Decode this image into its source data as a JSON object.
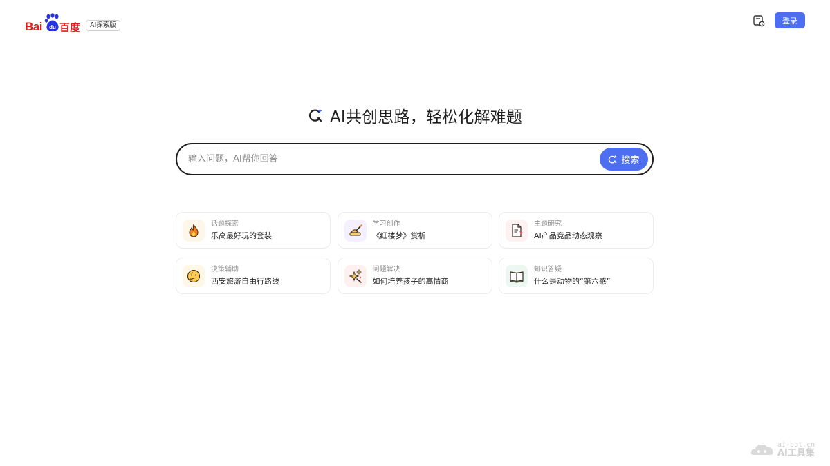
{
  "header": {
    "logo": {
      "wordmark_latin": "Bai",
      "wordmark_paw": "du",
      "wordmark_cn": "百度",
      "badge": "AI探索版"
    },
    "login_label": "登录",
    "icons": {
      "history": "history-icon"
    }
  },
  "main": {
    "title": "AI共创思路，轻松化解难题",
    "search": {
      "placeholder": "输入问题，AI帮你回答",
      "value": "",
      "button_label": "搜索"
    },
    "suggestions": [
      {
        "category": "话题探索",
        "question": "乐高最好玩的套装",
        "icon": "fire-icon",
        "bg": "#fff6ea"
      },
      {
        "category": "学习创作",
        "question": "《红楼梦》赏析",
        "icon": "writing-hand-icon",
        "bg": "#f5f0ff"
      },
      {
        "category": "主题研究",
        "question": "AI产品竞品动态观察",
        "icon": "document-icon",
        "bg": "#fdf1f1"
      },
      {
        "category": "决策辅助",
        "question": "西安旅游自由行路线",
        "icon": "thinking-face-icon",
        "bg": "#fff7e6"
      },
      {
        "category": "问题解决",
        "question": "如何培养孩子的高情商",
        "icon": "sparkle-icon",
        "bg": "#fff0f0"
      },
      {
        "category": "知识答疑",
        "question": "什么是动物的“第六感”",
        "icon": "open-book-icon",
        "bg": "#ecf7f1"
      }
    ]
  },
  "watermark": {
    "url": "ai-bot.cn",
    "name": "AI工具集"
  },
  "colors": {
    "accent": "#4e6ef2",
    "brand_red": "#de1e1a",
    "brand_blue": "#2932e1"
  }
}
